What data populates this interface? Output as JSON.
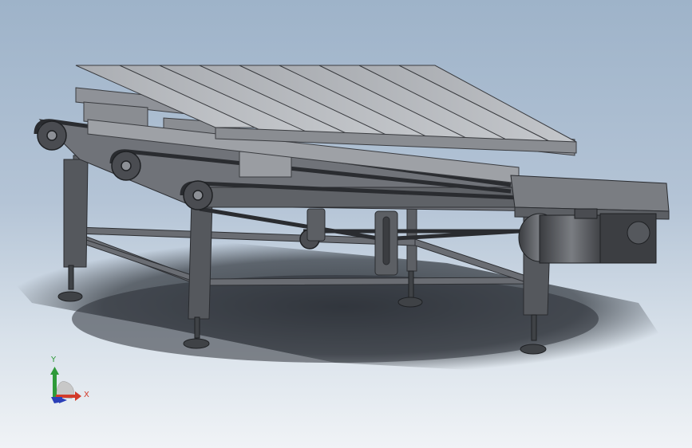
{
  "viewport": {
    "background_top": "#9eb3c9",
    "background_bottom": "#f0f3f6"
  },
  "model": {
    "description_icon": "belt-conveyor-with-pallet",
    "colors": {
      "steel_dark": "#4b4d52",
      "steel_mid": "#6a6d73",
      "steel_light": "#8d9096",
      "pallet_top": "#b9bcc1",
      "pallet_side": "#8f9298",
      "shadow": "#2b3036"
    }
  },
  "triad": {
    "x_label": "X",
    "y_label": "Y",
    "x_color": "#d23b2a",
    "y_color": "#2f9a3a",
    "z_color": "#2b3fb8"
  }
}
